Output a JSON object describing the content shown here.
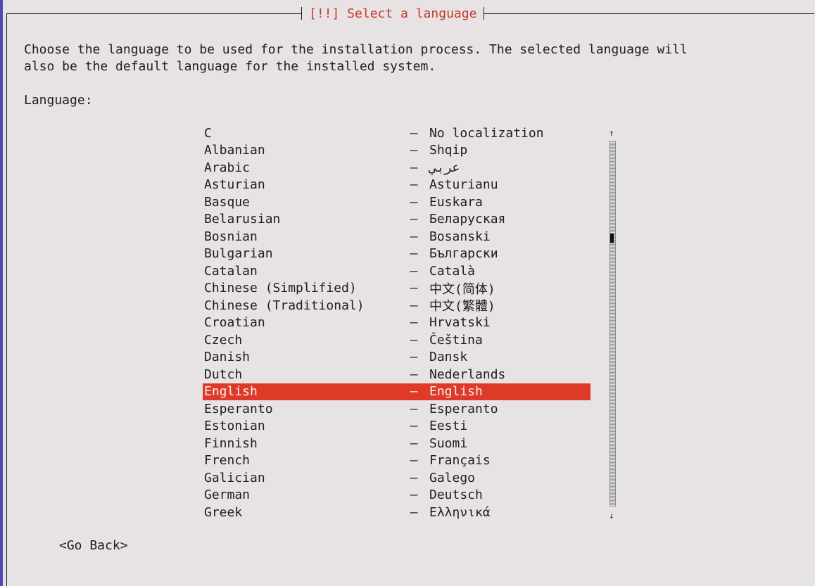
{
  "dialog": {
    "title": "[!!] Select a language",
    "description_line1": "Choose the language to be used for the installation process. The selected language will",
    "description_line2": "also be the default language for the installed system.",
    "field_label": "Language:",
    "separator": "–",
    "languages": [
      {
        "name": "C",
        "native": "No localization"
      },
      {
        "name": "Albanian",
        "native": "Shqip"
      },
      {
        "name": "Arabic",
        "native": "عربي"
      },
      {
        "name": "Asturian",
        "native": "Asturianu"
      },
      {
        "name": "Basque",
        "native": "Euskara"
      },
      {
        "name": "Belarusian",
        "native": "Беларуская"
      },
      {
        "name": "Bosnian",
        "native": "Bosanski"
      },
      {
        "name": "Bulgarian",
        "native": "Български"
      },
      {
        "name": "Catalan",
        "native": "Català"
      },
      {
        "name": "Chinese (Simplified)",
        "native": "中文(简体)"
      },
      {
        "name": "Chinese (Traditional)",
        "native": "中文(繁體)"
      },
      {
        "name": "Croatian",
        "native": "Hrvatski"
      },
      {
        "name": "Czech",
        "native": "Čeština"
      },
      {
        "name": "Danish",
        "native": "Dansk"
      },
      {
        "name": "Dutch",
        "native": "Nederlands"
      },
      {
        "name": "English",
        "native": "English",
        "selected": true
      },
      {
        "name": "Esperanto",
        "native": "Esperanto"
      },
      {
        "name": "Estonian",
        "native": "Eesti"
      },
      {
        "name": "Finnish",
        "native": "Suomi"
      },
      {
        "name": "French",
        "native": "Français"
      },
      {
        "name": "Galician",
        "native": "Galego"
      },
      {
        "name": "German",
        "native": "Deutsch"
      },
      {
        "name": "Greek",
        "native": "Ελληνικά"
      }
    ],
    "scroll_up_icon": "arrow-up-icon",
    "scroll_down_icon": "arrow-down-icon",
    "go_back_label": "<Go Back>"
  },
  "colors": {
    "background": "#e7e3e4",
    "selection": "#de3a27",
    "title": "#c6382a",
    "left_edge": "#4f46b8"
  }
}
